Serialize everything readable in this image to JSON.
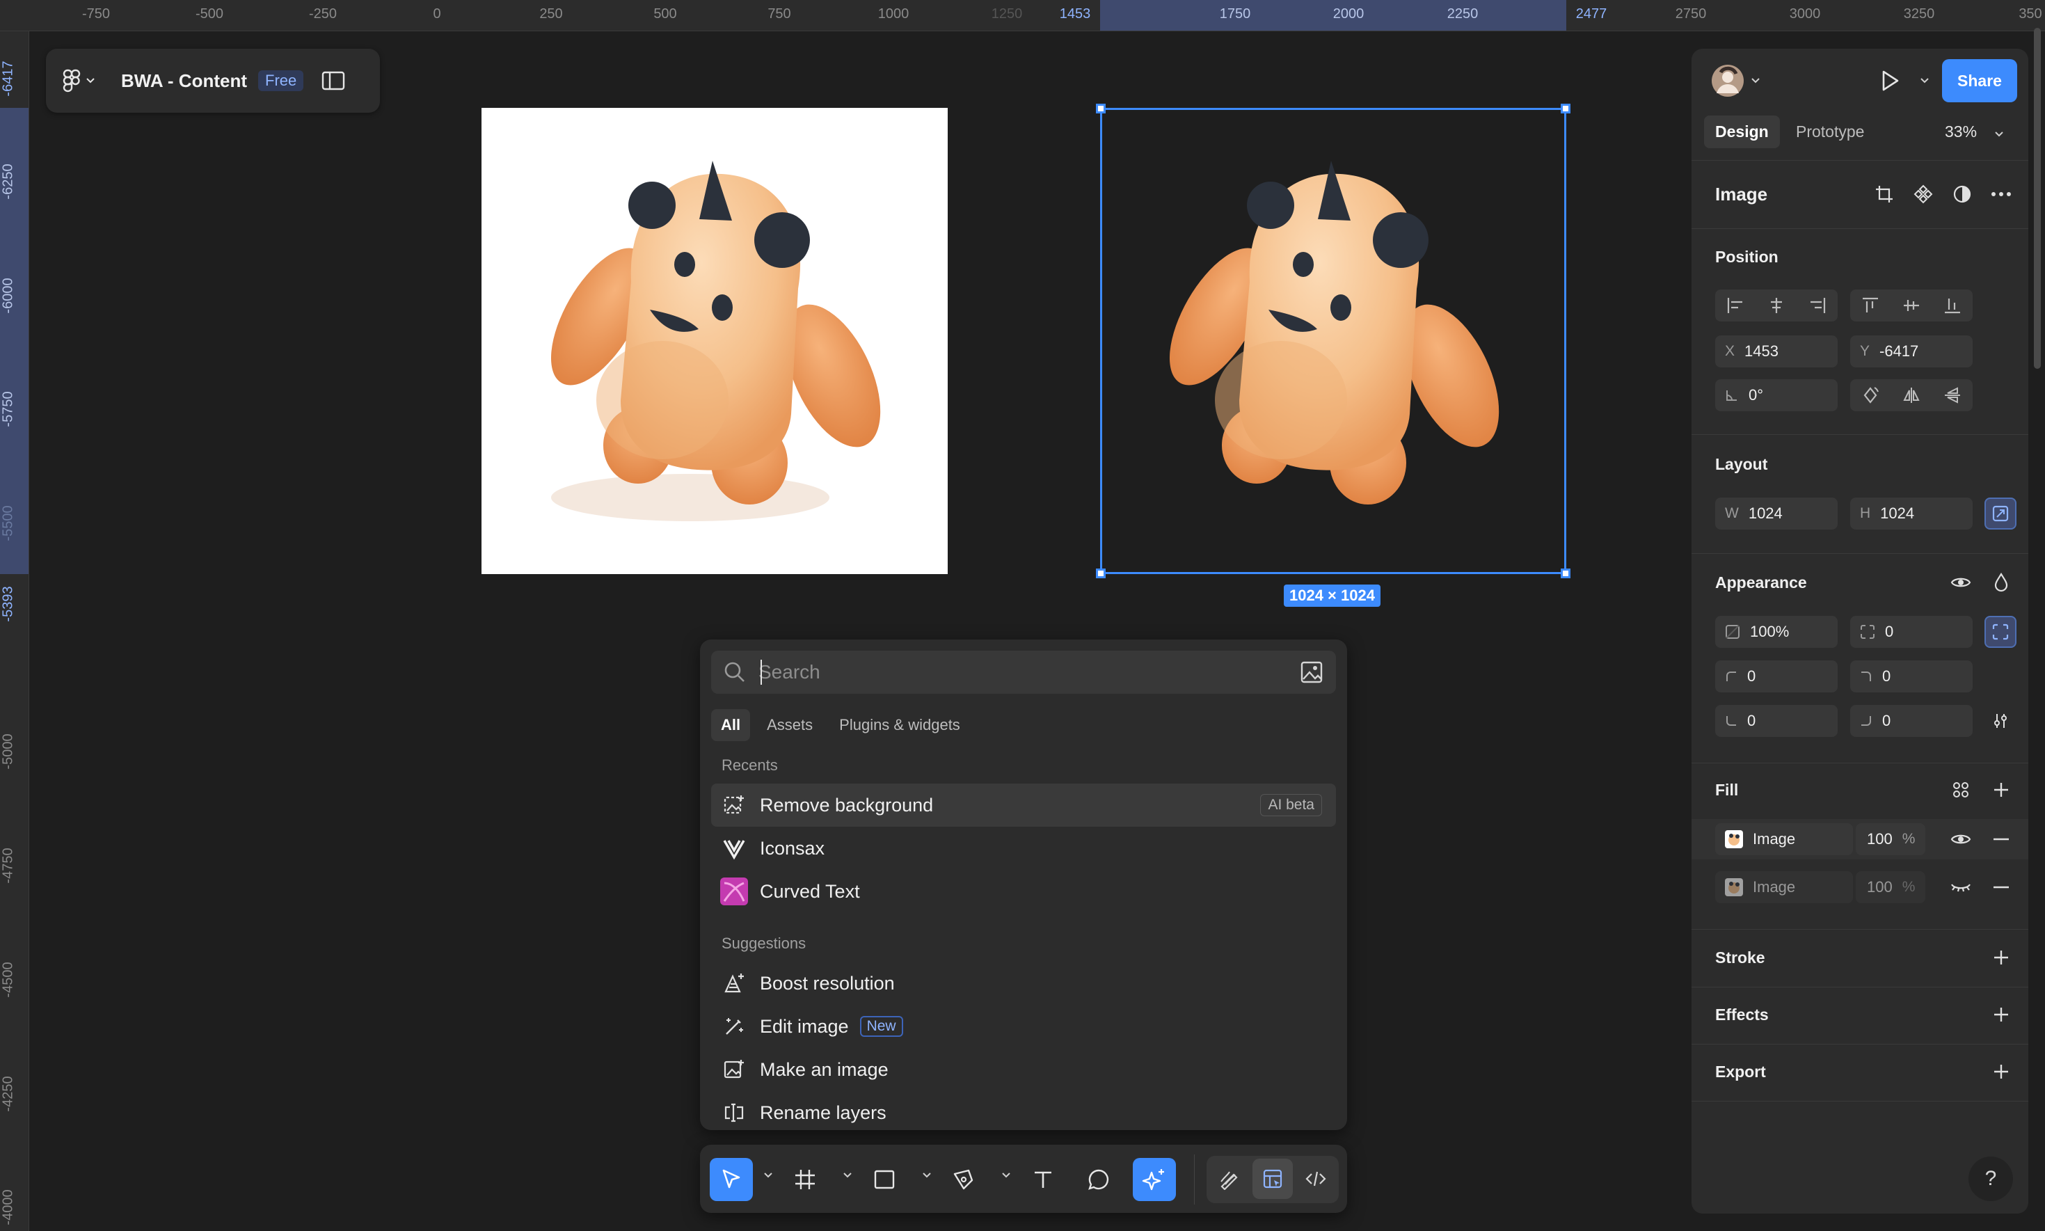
{
  "ruler_top": {
    "labels": [
      "-750",
      "-500",
      "-250",
      "0",
      "250",
      "500",
      "750",
      "1000",
      "1250",
      "1453",
      "1750",
      "2000",
      "2250",
      "2477",
      "2750",
      "3000",
      "3250",
      "350"
    ],
    "highlight_start": "1453",
    "highlight_end": "2477"
  },
  "ruler_left": {
    "labels": [
      "-6417",
      "-6250",
      "-6000",
      "-5750",
      "-5500",
      "-5393",
      "-5000",
      "-4750",
      "-4500",
      "-4250",
      "-4000"
    ]
  },
  "file": {
    "title": "BWA - Content",
    "plan_badge": "Free"
  },
  "canvas": {
    "selection_dimensions": "1024 × 1024"
  },
  "quick_actions": {
    "search_placeholder": "Search",
    "tabs": [
      "All",
      "Assets",
      "Plugins & widgets"
    ],
    "recents_heading": "Recents",
    "recents": [
      {
        "label": "Remove background",
        "badge": "AI beta",
        "icon": "remove-background-icon"
      },
      {
        "label": "Iconsax",
        "icon": "iconsax-plugin-icon"
      },
      {
        "label": "Curved Text",
        "icon": "curved-text-plugin-icon"
      }
    ],
    "suggestions_heading": "Suggestions",
    "suggestions": [
      {
        "label": "Boost resolution",
        "icon": "boost-resolution-icon"
      },
      {
        "label": "Edit image",
        "badge": "New",
        "icon": "edit-image-icon"
      },
      {
        "label": "Make an image",
        "icon": "make-image-icon"
      },
      {
        "label": "Rename layers",
        "icon": "rename-layers-icon"
      }
    ]
  },
  "right_panel": {
    "share_label": "Share",
    "tabs": {
      "design": "Design",
      "prototype": "Prototype"
    },
    "zoom": "33%",
    "selection_type": "Image",
    "position": {
      "title": "Position",
      "x_prefix": "X",
      "x": "1453",
      "y_prefix": "Y",
      "y": "-6417",
      "rotation": "0°"
    },
    "layout": {
      "title": "Layout",
      "w_prefix": "W",
      "w": "1024",
      "h_prefix": "H",
      "h": "1024"
    },
    "appearance": {
      "title": "Appearance",
      "opacity": "100%",
      "radius_all": "0",
      "radius_tl": "0",
      "radius_tr": "0",
      "radius_bl": "0",
      "radius_br": "0"
    },
    "fill": {
      "title": "Fill",
      "layers": [
        {
          "label": "Image",
          "opacity": "100",
          "unit": "%",
          "visible": true
        },
        {
          "label": "Image",
          "opacity": "100",
          "unit": "%",
          "visible": false
        }
      ]
    },
    "stroke": {
      "title": "Stroke"
    },
    "effects": {
      "title": "Effects"
    },
    "export": {
      "title": "Export"
    },
    "help": "?"
  },
  "colors": {
    "accent": "#3d8bfd",
    "canvas_bg": "#1e1e1e",
    "panel_bg": "#2c2c2c",
    "highlight": "#3f4a6e"
  }
}
